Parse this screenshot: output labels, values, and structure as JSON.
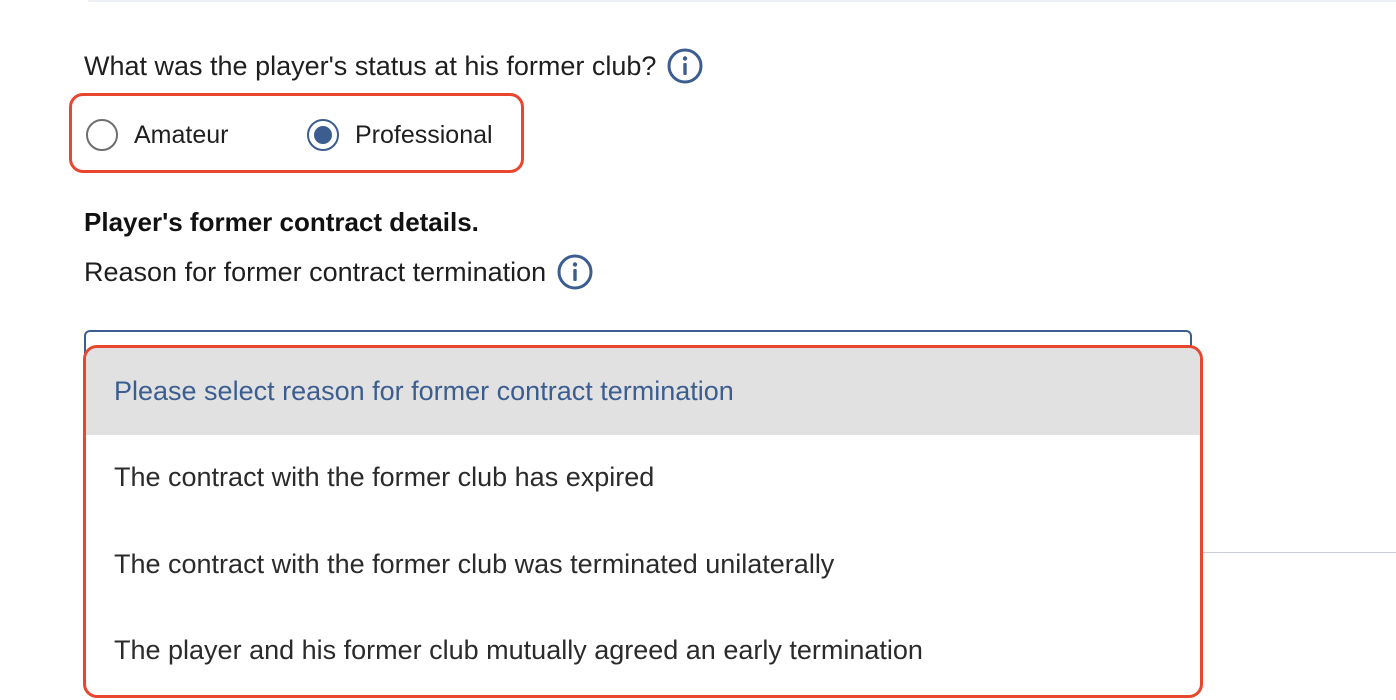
{
  "question": {
    "text": "What was the player's status at his former club?",
    "info_icon": "info-icon"
  },
  "status_options": [
    {
      "label": "Amateur",
      "selected": false
    },
    {
      "label": "Professional",
      "selected": true
    }
  ],
  "section": {
    "title": "Player's former contract details."
  },
  "termination": {
    "label": "Reason for former contract termination",
    "info_icon": "info-icon",
    "options": [
      "Please select reason for former contract termination",
      "The contract with the former club has expired",
      "The contract with the former club was terminated unilaterally",
      "The player and his former club mutually agreed an early termination"
    ]
  },
  "colors": {
    "accent": "#3b5d8f",
    "highlight": "#e8462f",
    "placeholder_bg": "#e1e1e1"
  }
}
